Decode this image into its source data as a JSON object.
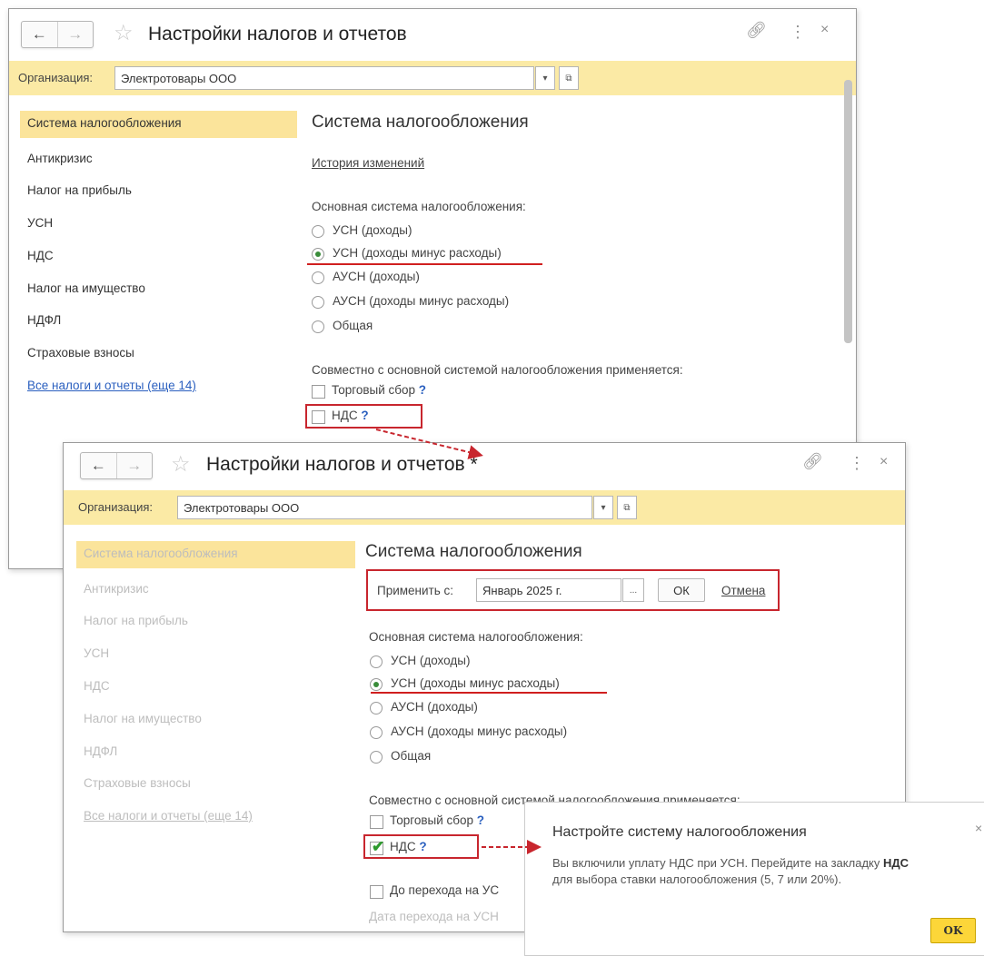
{
  "window1": {
    "title": "Настройки налогов и отчетов",
    "org_label": "Организация:",
    "org_value": "Электротовары ООО",
    "nav": [
      "Система налогообложения",
      "Антикризис",
      "Налог на прибыль",
      "УСН",
      "НДС",
      "Налог на имущество",
      "НДФЛ",
      "Страховые взносы",
      "Все налоги и отчеты (еще 14)"
    ],
    "section_title": "Система налогообложения",
    "history_link": "История изменений",
    "main_system_label": "Основная система налогообложения:",
    "options": [
      "УСН (доходы)",
      "УСН (доходы минус расходы)",
      "АУСН (доходы)",
      "АУСН (доходы минус расходы)",
      "Общая"
    ],
    "selected_option": "УСН (доходы минус расходы)",
    "combined_label": "Совместно с основной системой налогообложения применяется:",
    "trade_fee": "Торговый сбор",
    "vat": "НДС",
    "help": "?"
  },
  "window2": {
    "title": "Настройки налогов и отчетов *",
    "org_label": "Организация:",
    "org_value": "Электротовары ООО",
    "nav": [
      "Система налогообложения",
      "Антикризис",
      "Налог на прибыль",
      "УСН",
      "НДС",
      "Налог на имущество",
      "НДФЛ",
      "Страховые взносы",
      "Все налоги и отчеты (еще 14)"
    ],
    "section_title": "Система налогообложения",
    "apply_from_label": "Применить с:",
    "apply_from_value": "Январь 2025 г.",
    "ellipsis": "...",
    "ok_label": "ОК",
    "cancel_link": "Отмена",
    "main_system_label": "Основная система налогообложения:",
    "options": [
      "УСН (доходы)",
      "УСН (доходы минус расходы)",
      "АУСН (доходы)",
      "АУСН (доходы минус расходы)",
      "Общая"
    ],
    "selected_option": "УСН (доходы минус расходы)",
    "combined_label": "Совместно с основной системой налогообложения применяется:",
    "trade_fee": "Торговый сбор",
    "vat": "НДС",
    "vat_checked": true,
    "help": "?",
    "transition_checkbox": "До перехода на УС",
    "transition_date": "Дата перехода на УСН"
  },
  "popup": {
    "title": "Настройте систему налогообложения",
    "line1_text": "Вы включили уплату НДС при УСН. Перейдите на закладку ",
    "line1_bold": "НДС",
    "line2": "для выбора ставки налогообложения (5, 7 или 20%).",
    "ok_label": "OK",
    "close": "×"
  },
  "colors": {
    "org_bar": "#fbeaa5",
    "active_nav": "#fbe49b",
    "accent_red": "#c8262e",
    "link": "#2a5fbf",
    "ok_button": "#fcd639"
  },
  "icons": [
    "back-arrow-icon",
    "forward-arrow-icon",
    "star-icon",
    "link-icon",
    "more-icon",
    "close-icon",
    "dropdown-icon",
    "open-icon",
    "checkmark-icon",
    "help-icon"
  ]
}
